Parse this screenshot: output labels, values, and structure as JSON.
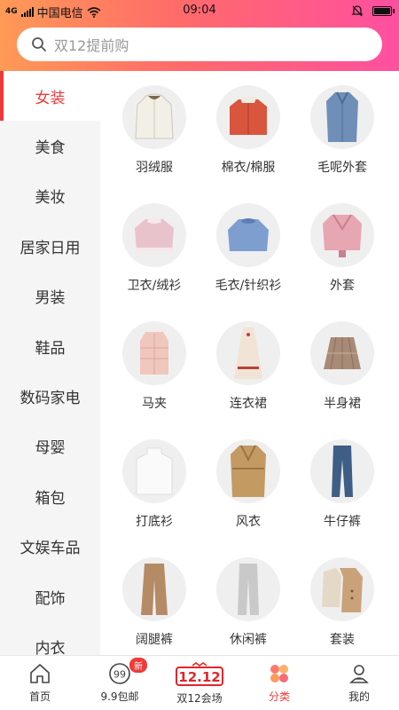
{
  "status_bar": {
    "network": "4G",
    "carrier": "中国电信",
    "time": "09:04"
  },
  "search": {
    "placeholder": "双12提前购"
  },
  "sidebar": {
    "items": [
      {
        "label": "女装",
        "active": true
      },
      {
        "label": "美食"
      },
      {
        "label": "美妆"
      },
      {
        "label": "居家日用"
      },
      {
        "label": "男装"
      },
      {
        "label": "鞋品"
      },
      {
        "label": "数码家电"
      },
      {
        "label": "母婴"
      },
      {
        "label": "箱包"
      },
      {
        "label": "文娱车品"
      },
      {
        "label": "配饰"
      },
      {
        "label": "内衣"
      }
    ]
  },
  "categories": [
    {
      "label": "羽绒服",
      "icon": "down-jacket-icon",
      "color": "#f2efe6"
    },
    {
      "label": "棉衣/棉服",
      "icon": "cotton-jacket-icon",
      "color": "#d9553d"
    },
    {
      "label": "毛呢外套",
      "icon": "wool-coat-icon",
      "color": "#6f8fb8"
    },
    {
      "label": "卫衣/绒衫",
      "icon": "sweatshirt-icon",
      "color": "#e9c3cc"
    },
    {
      "label": "毛衣/针织衫",
      "icon": "sweater-icon",
      "color": "#7f9ed0"
    },
    {
      "label": "外套",
      "icon": "leather-jacket-icon",
      "color": "#e6a6b2"
    },
    {
      "label": "马夹",
      "icon": "vest-icon",
      "color": "#f0c7bd"
    },
    {
      "label": "连衣裙",
      "icon": "dress-icon",
      "color": "#f1e4d6"
    },
    {
      "label": "半身裙",
      "icon": "skirt-icon",
      "color": "#a78b76"
    },
    {
      "label": "打底衫",
      "icon": "turtleneck-icon",
      "color": "#fafafa"
    },
    {
      "label": "风衣",
      "icon": "trench-coat-icon",
      "color": "#c49a63"
    },
    {
      "label": "牛仔裤",
      "icon": "jeans-icon",
      "color": "#3f5e86"
    },
    {
      "label": "阔腿裤",
      "icon": "wide-pants-icon",
      "color": "#b58b66"
    },
    {
      "label": "休闲裤",
      "icon": "casual-pants-icon",
      "color": "#c9c9c9"
    },
    {
      "label": "套装",
      "icon": "suit-set-icon",
      "color": "#caa27a"
    }
  ],
  "tabbar": {
    "items": [
      {
        "label": "首页",
        "icon": "home-icon"
      },
      {
        "label": "9.9包邮",
        "icon": "ninety-nine-icon",
        "badge": "新"
      },
      {
        "label": "双12会场",
        "icon": "double12-icon"
      },
      {
        "label": "分类",
        "icon": "category-icon",
        "active": true
      },
      {
        "label": "我的",
        "icon": "profile-icon"
      }
    ]
  },
  "colors": {
    "accent": "#f03a3a",
    "header_start": "#ff9a56",
    "header_end": "#ff4fa0"
  }
}
